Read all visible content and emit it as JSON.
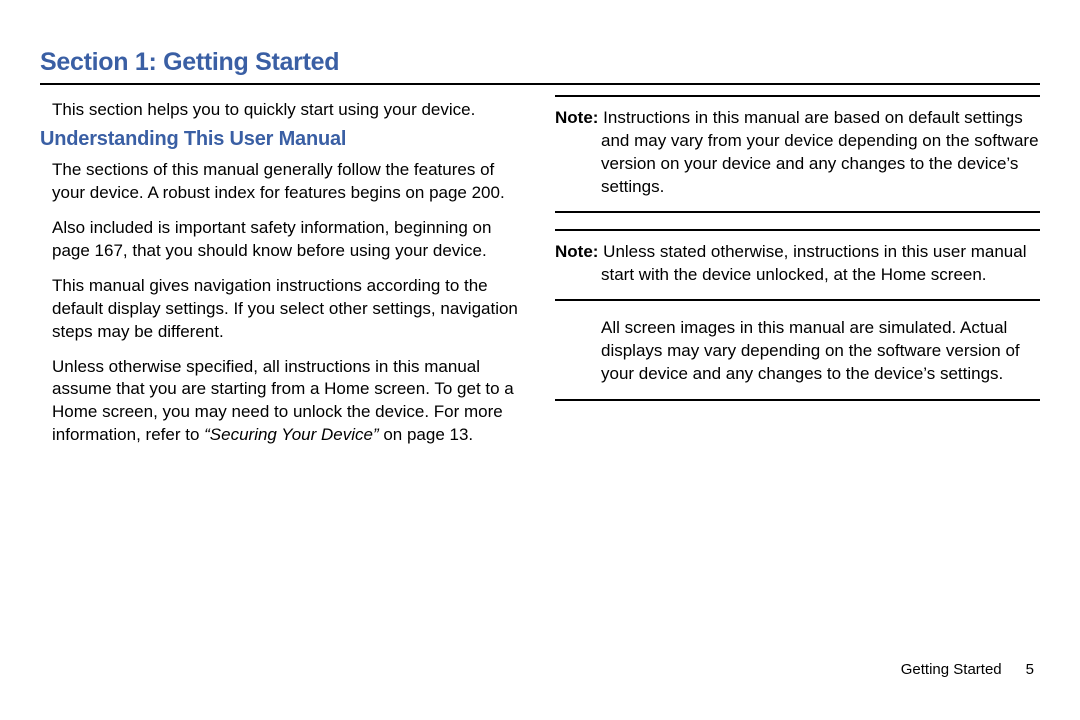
{
  "section_title": "Section 1: Getting Started",
  "left": {
    "intro": "This section helps you to quickly start using your device.",
    "subheading": "Understanding This User Manual",
    "p1": "The sections of this manual generally follow the features of your device. A robust index for features begins on page 200.",
    "p2": "Also included is important safety information, beginning on page 167, that you should know before using your device.",
    "p3": "This manual gives navigation instructions according to the default display settings. If you select other settings, navigation steps may be different.",
    "p4_a": "Unless otherwise specified, all instructions in this manual assume that you are starting from a Home screen. To get to a Home screen, you may need to unlock the device. For more information, refer to ",
    "p4_ref": "“Securing Your Device” ",
    "p4_b": " on page 13."
  },
  "right": {
    "note1_label": "Note:",
    "note1_text": " Instructions in this manual are based on default settings and may vary from your device depending on the software version on your device and any changes to the device’s settings.",
    "note2_label": "Note:",
    "note2_text": " Unless stated otherwise, instructions in this user manual start with the device unlocked, at the Home screen.",
    "after_note": "All screen images in this manual are simulated. Actual displays may vary depending on the software version of your device and any changes to the device’s settings."
  },
  "footer": {
    "label": "Getting Started",
    "page": "5"
  }
}
